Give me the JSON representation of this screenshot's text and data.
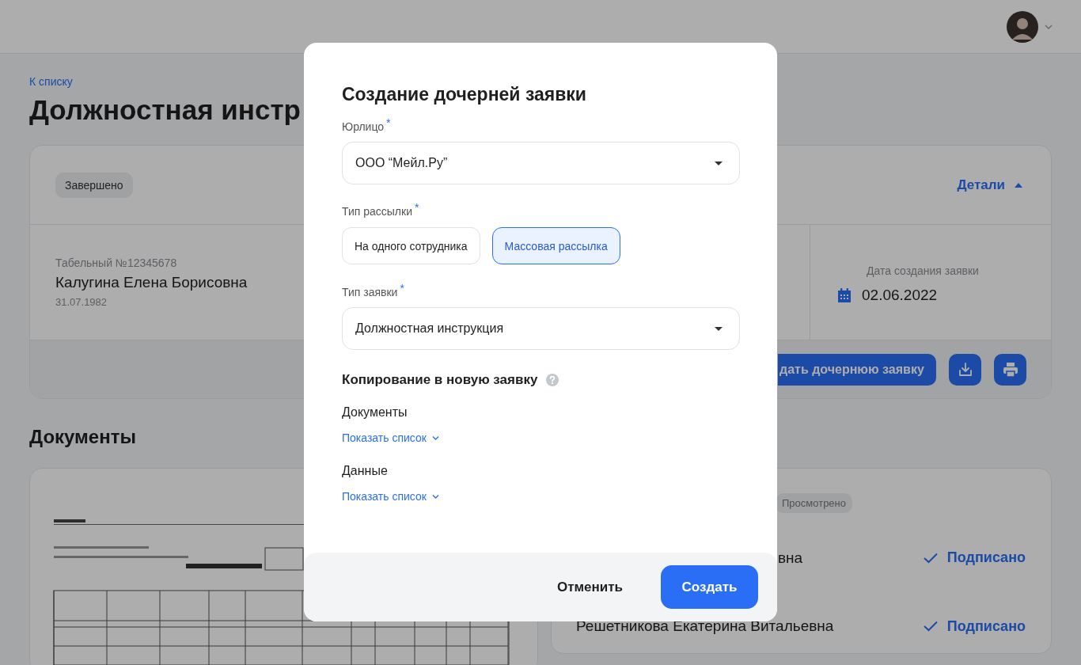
{
  "back_link": "К списку",
  "page_title": "Должностная инстр",
  "request_card": {
    "status": "Завершено",
    "details_toggle": {
      "label": "Детали",
      "expanded": true
    },
    "employee": {
      "personnel_number": "Табельный №12345678",
      "name": "Калугина Елена Борисовна",
      "birth_date": "31.07.1982"
    },
    "created": {
      "label": "Дата создания заявки",
      "date": "02.06.2022"
    },
    "create_child_button": "дать дочернюю заявку"
  },
  "documents_heading": "Документы",
  "signatures": {
    "status": "Просмотрено",
    "rows": [
      {
        "name": "вна",
        "status": "Подписано"
      },
      {
        "name": "Решетникова Екатерина Витальевна",
        "status": "Подписано"
      }
    ]
  },
  "modal": {
    "title": "Создание дочерней заявки",
    "legal_entity": {
      "label": "Юрлицо",
      "mark": "*",
      "value": "ООО “Мейл.Ру”"
    },
    "mailing_type": {
      "label": "Тип рассылки",
      "mark": "*",
      "options": [
        {
          "label": "На одного сотрудника",
          "selected": false
        },
        {
          "label": "Массовая рассылка",
          "selected": true
        }
      ]
    },
    "request_type": {
      "label": "Тип заявки",
      "mark": "*",
      "value": "Должностная инструкция"
    },
    "copy_heading": "Копирование в новую заявку",
    "copy_sections": [
      {
        "label": "Документы",
        "link": "Показать список",
        "expanded": false
      },
      {
        "label": "Данные",
        "link": "Показать список",
        "expanded": false
      }
    ],
    "cancel_button": "Отменить",
    "create_button": "Создать"
  }
}
